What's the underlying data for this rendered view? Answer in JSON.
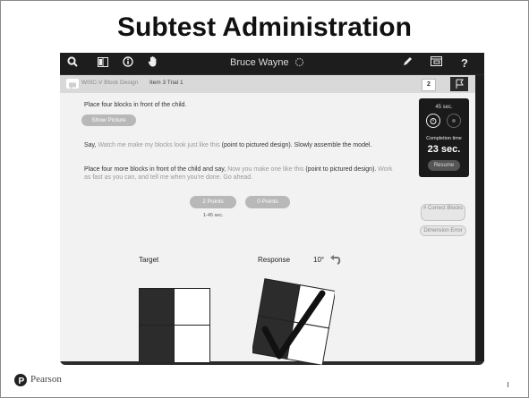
{
  "slide_title": "Subtest Administration",
  "topbar": {
    "username": "Bruce Wayne",
    "icons": [
      "search-icon",
      "book-icon",
      "info-icon",
      "hand-icon",
      "spinner-icon",
      "pencil-icon",
      "window-icon",
      "help-icon"
    ],
    "help_glyph": "?"
  },
  "subbar": {
    "subtest": "WISC-V Block Design",
    "item": "Item 3 Trial 1",
    "count": "2"
  },
  "instructions": {
    "line1": "Place four blocks in front of the child.",
    "show_picture": "Show Picture",
    "say1_prefix": "Say, ",
    "say1_spoken": "Watch me make my blocks look just like this",
    "say1_suffix": " (point to pictured design). Slowly assemble the model.",
    "say2_prefix": "Place four more blocks in front of the child and say, ",
    "say2_spoken1": "Now you make one like this",
    "say2_mid": " (point to pictured design). ",
    "say2_spoken2": "Work as fast as you can, and tell me when you're done. Go ahead."
  },
  "scoring": {
    "two_points": "2 Points",
    "zero_points": "0 Points",
    "range": "1-45 sec."
  },
  "timer": {
    "limit": "45 sec.",
    "completion_label": "Completion time",
    "completion_value": "23 sec.",
    "resume": "Resume"
  },
  "side_buttons": {
    "correct_blocks": "# Correct Blocks",
    "dimension_error": "Dimension Error"
  },
  "design": {
    "target_label": "Target",
    "response_label": "Response",
    "rotation": "10°"
  },
  "footer": {
    "brand": "Pearson"
  }
}
